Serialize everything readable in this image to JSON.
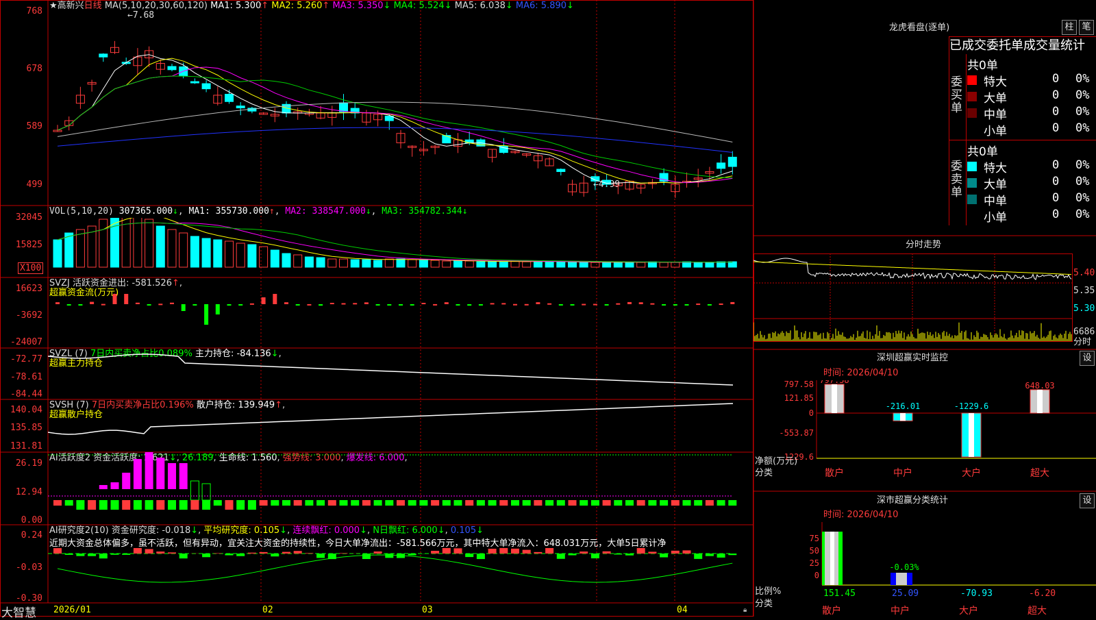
{
  "app": {
    "brand": "大智慧"
  },
  "main": {
    "title": "★高新兴",
    "period": "日线",
    "ma_line": {
      "label": "MA(5,10,20,30,60,120)",
      "ma1": "MA1: 5.300",
      "ma2": "MA2: 5.260",
      "ma3": "MA3: 5.350",
      "ma4": "MA4: 5.524",
      "ma5": "MA5: 6.038",
      "ma6": "MA6: 5.890"
    },
    "high_mark": "7.68",
    "low_mark": "4.99",
    "y_ticks": [
      "768",
      "678",
      "589",
      "499"
    ]
  },
  "vol": {
    "header": "VOL(5,10,20)",
    "value": "307365.000",
    "ma1": "MA1: 355730.000",
    "ma2": "MA2: 338547.000",
    "ma3": "MA3: 354782.344",
    "y_ticks": [
      "32045",
      "15825"
    ],
    "unit": "X100"
  },
  "svzj": {
    "header": "SVZJ  活跃资金进出: -581.526",
    "sub": "超赢资金流(万元)",
    "y_ticks": [
      "16623",
      "-3692",
      "-24007"
    ]
  },
  "svzl": {
    "header_a": "SVZL (7)",
    "header_b": "7日内买卖净占比0.089%",
    "header_c": "主力持仓: -84.136",
    "sub": "超赢主力持仓",
    "y_ticks": [
      "-72.77",
      "-78.61",
      "-84.44"
    ]
  },
  "svsh": {
    "header_a": "SVSH (7)",
    "header_b": "7日内买卖净占比0.196%",
    "header_c": "散户持仓: 139.949",
    "sub": "超赢散户持仓",
    "y_ticks": [
      "140.04",
      "135.85",
      "131.81"
    ]
  },
  "ai1": {
    "header_a": "AI活跃度2 资金活跃度: 1.621",
    "header_b": "26.189",
    "header_c": "生命线: 1.560",
    "header_d": "强势线: 3.000",
    "header_e": "爆发线: 6.000",
    "y_ticks": [
      "26.19",
      "12.94",
      "0.00"
    ]
  },
  "ai2": {
    "header_a": "AI研究度2(10) 资金研究度: -0.018",
    "header_b": "平均研究度: 0.105",
    "header_c": "连续飘红: 0.000",
    "header_d": "N日飘红: 6.000",
    "header_e": "0.105",
    "note": "近期大资金总体偏多，虽不活跃，但有异动，宜关注大资金的持续性，今日大单净流出：-581.566万元，其中特大单净流入：648.031万元，大单5日累计净",
    "y_ticks": [
      "0.24",
      "-0.03",
      "-0.30"
    ]
  },
  "x_axis": [
    "2026/01",
    "02",
    "03",
    "04"
  ],
  "longhu": {
    "title": "龙虎看盘(逐单)",
    "btn_zhu": "柱",
    "btn_bi": "笔",
    "header": "已成交委托单成交量统计",
    "buy": {
      "label": "委买单",
      "total": "共0单",
      "rows": [
        {
          "name": "特大",
          "n": "0",
          "p": "0%",
          "color": "#ff0000"
        },
        {
          "name": "大单",
          "n": "0",
          "p": "0%",
          "color": "#8b0000"
        },
        {
          "name": "中单",
          "n": "0",
          "p": "0%",
          "color": "#6a0000"
        },
        {
          "name": "小单",
          "n": "0",
          "p": "0%",
          "color": "#000000"
        }
      ]
    },
    "sell": {
      "label": "委卖单",
      "total": "共0单",
      "rows": [
        {
          "name": "特大",
          "n": "0",
          "p": "0%",
          "color": "#00ffff"
        },
        {
          "name": "大单",
          "n": "0",
          "p": "0%",
          "color": "#008b8b"
        },
        {
          "name": "中单",
          "n": "0",
          "p": "0%",
          "color": "#007070"
        },
        {
          "name": "小单",
          "n": "0",
          "p": "0%",
          "color": "#000000"
        }
      ]
    }
  },
  "intraday": {
    "title": "分时走势",
    "prices": [
      "5.40",
      "5.35",
      "5.30"
    ],
    "vol_max": "6686",
    "vol_label": "分时"
  },
  "sz_monitor": {
    "title": "深圳超赢实时监控",
    "btn": "设",
    "time": "时间: 2026/04/10",
    "y_ticks": [
      "797.58",
      "121.85",
      "0",
      "-553.87",
      "-1229.6"
    ],
    "y_label_a": "净额(万元)",
    "y_label_b": "分类",
    "categories": [
      "散户",
      "中户",
      "大户",
      "超大"
    ],
    "values": [
      797.58,
      -216.01,
      -1229.6,
      648.03
    ],
    "labels": [
      "797.58",
      "-216.01",
      "-1229.6",
      "648.03"
    ]
  },
  "sz_class": {
    "title": "深市超赢分类统计",
    "btn": "设",
    "time": "时间: 2026/04/10",
    "y_ticks": [
      "75",
      "50",
      "25",
      "0"
    ],
    "y_label_a": "比例%",
    "y_label_b": "分类",
    "categories": [
      "散户",
      "中户",
      "大户",
      "超大"
    ],
    "pct_label": "-0.03%",
    "values": [
      "151.45",
      "25.09",
      "-70.93",
      "-6.20"
    ]
  }
}
